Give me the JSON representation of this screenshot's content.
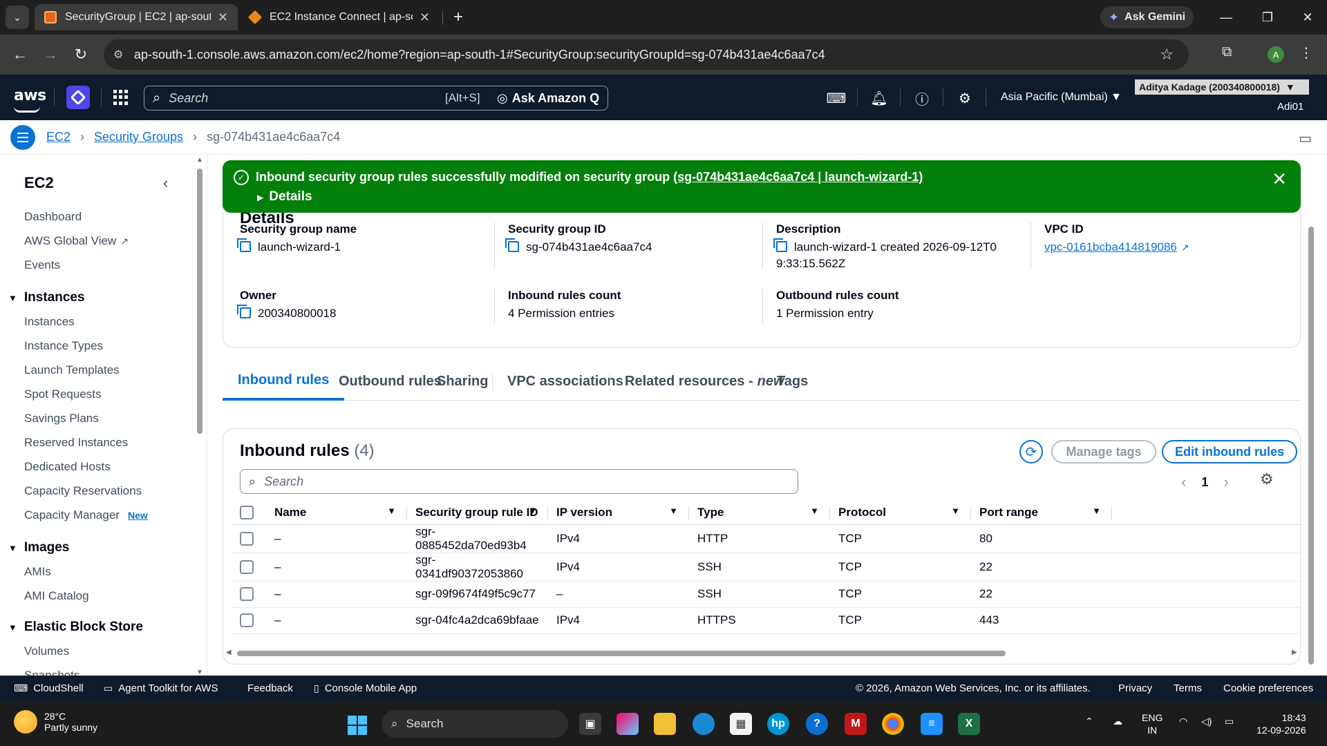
{
  "browser": {
    "tabs": [
      {
        "title": "SecurityGroup | EC2 | ap-south-",
        "active": true
      },
      {
        "title": "EC2 Instance Connect | ap-south-",
        "active": false
      }
    ],
    "gemini_label": "Ask Gemini",
    "url": "ap-south-1.console.aws.amazon.com/ec2/home?region=ap-south-1#SecurityGroup:securityGroupId=sg-074b431ae4c6aa7c4",
    "profile_initial": "A"
  },
  "awsnav": {
    "logo": "aws",
    "search_placeholder": "Search",
    "search_shortcut": "[Alt+S]",
    "ask_q": "Ask Amazon Q",
    "region": "Asia Pacific (Mumbai)",
    "account": "Aditya Kadage (200340800018)",
    "user": "Adi01"
  },
  "breadcrumb": {
    "items": [
      "EC2",
      "Security Groups"
    ],
    "current": "sg-074b431ae4c6aa7c4"
  },
  "sidebar": {
    "title": "EC2",
    "top_items": [
      "Dashboard",
      "AWS Global View",
      "Events"
    ],
    "sections": [
      {
        "title": "Instances",
        "items": [
          "Instances",
          "Instance Types",
          "Launch Templates",
          "Spot Requests",
          "Savings Plans",
          "Reserved Instances",
          "Dedicated Hosts",
          "Capacity Reservations",
          "Capacity Manager"
        ]
      },
      {
        "title": "Images",
        "items": [
          "AMIs",
          "AMI Catalog"
        ]
      },
      {
        "title": "Elastic Block Store",
        "items": [
          "Volumes",
          "Snapshots"
        ]
      }
    ],
    "new_badge": "New"
  },
  "flash": {
    "message": "Inbound security group rules successfully modified on security group ",
    "link": "(sg-074b431ae4c6aa7c4 | launch-wizard-1)",
    "details": "Details"
  },
  "details": {
    "header": "Details",
    "sg_name_label": "Security group name",
    "sg_name": "launch-wizard-1",
    "sg_id_label": "Security group ID",
    "sg_id": "sg-074b431ae4c6aa7c4",
    "description_label": "Description",
    "description": "launch-wizard-1 created 2026-09-12T0 9:33:15.562Z",
    "vpc_label": "VPC ID",
    "vpc": "vpc-0161bcba414819086",
    "owner_label": "Owner",
    "owner": "200340800018",
    "inbound_count_label": "Inbound rules count",
    "inbound_count": "4 Permission entries",
    "outbound_count_label": "Outbound rules count",
    "outbound_count": "1 Permission entry"
  },
  "tabs": [
    "Inbound rules",
    "Outbound rules",
    "Sharing",
    "VPC associations",
    "Related resources - ",
    "Tags"
  ],
  "tabs_new_suffix": "new",
  "rules": {
    "title": "Inbound rules",
    "count": "(4)",
    "manage_tags": "Manage tags",
    "edit_inbound": "Edit inbound rules",
    "search_placeholder": "Search",
    "page": "1",
    "columns": [
      "Name",
      "Security group rule ID",
      "IP version",
      "Type",
      "Protocol",
      "Port range"
    ],
    "rows": [
      {
        "name": "–",
        "id": "sgr-0885452da70ed93b4",
        "ipver": "IPv4",
        "type": "HTTP",
        "protocol": "TCP",
        "port": "80"
      },
      {
        "name": "–",
        "id": "sgr-0341df90372053860",
        "ipver": "IPv4",
        "type": "SSH",
        "protocol": "TCP",
        "port": "22"
      },
      {
        "name": "–",
        "id": "sgr-09f9674f49f5c9c77",
        "ipver": "–",
        "type": "SSH",
        "protocol": "TCP",
        "port": "22"
      },
      {
        "name": "–",
        "id": "sgr-04fc4a2dca69bfaae",
        "ipver": "IPv4",
        "type": "HTTPS",
        "protocol": "TCP",
        "port": "443"
      }
    ]
  },
  "footer": {
    "cloudshell": "CloudShell",
    "agent_toolkit": "Agent Toolkit for AWS",
    "feedback": "Feedback",
    "mobile": "Console Mobile App",
    "copyright": "© 2026, Amazon Web Services, Inc. or its affiliates.",
    "privacy": "Privacy",
    "terms": "Terms",
    "cookies": "Cookie preferences"
  },
  "taskbar": {
    "temp": "28°C",
    "weather": "Partly sunny",
    "search": "Search",
    "lang1": "ENG",
    "lang2": "IN",
    "time": "18:43",
    "date": "12-09-2026"
  },
  "colors": {
    "accent": "#0972d3",
    "success": "#037f0c",
    "nav_bg": "#0f1b2a"
  }
}
